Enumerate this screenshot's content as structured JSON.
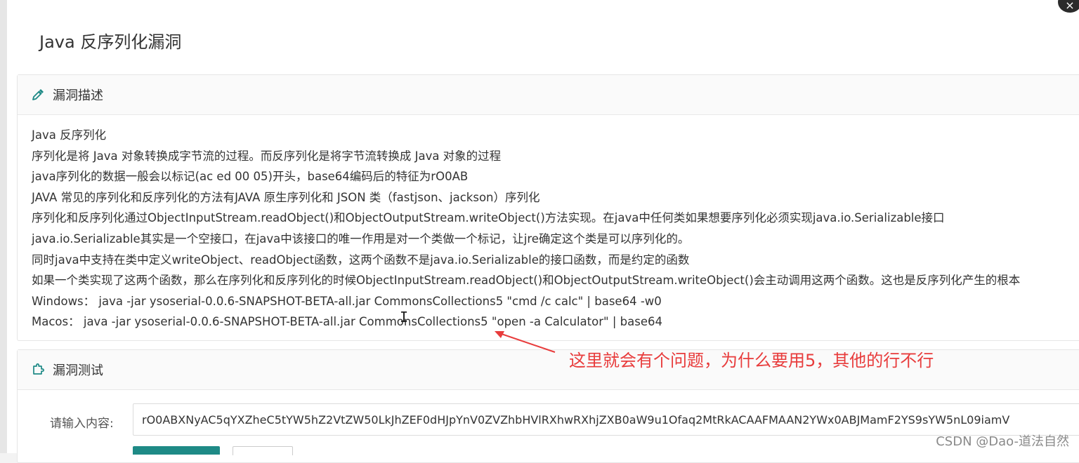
{
  "modal": {
    "title": "Java 反序列化漏洞",
    "close_symbol": "×"
  },
  "description_panel": {
    "heading": "漏洞描述",
    "icon": "eyedropper-icon",
    "lines": [
      "Java 反序列化",
      "序列化是将 Java 对象转换成字节流的过程。而反序列化是将字节流转换成 Java 对象的过程",
      "java序列化的数据一般会以标记(ac ed 00 05)开头，base64编码后的特征为rO0AB",
      "JAVA 常见的序列化和反序列化的方法有JAVA 原生序列化和 JSON 类（fastjson、jackson）序列化",
      "序列化和反序列化通过ObjectInputStream.readObject()和ObjectOutputStream.writeObject()方法实现。在java中任何类如果想要序列化必须实现java.io.Serializable接口",
      "java.io.Serializable其实是一个空接口，在java中该接口的唯一作用是对一个类做一个标记，让jre确定这个类是可以序列化的。",
      "同时java中支持在类中定义writeObject、readObject函数，这两个函数不是java.io.Serializable的接口函数，而是约定的函数",
      "如果一个类实现了这两个函数，那么在序列化和反序列化的时候ObjectInputStream.readObject()和ObjectOutputStream.writeObject()会主动调用这两个函数。这也是反序列化产生的根本",
      "Windows： java -jar ysoserial-0.0.6-SNAPSHOT-BETA-all.jar CommonsCollections5 \"cmd /c calc\" | base64 -w0",
      "Macos： java -jar ysoserial-0.0.6-SNAPSHOT-BETA-all.jar CommonsCollections5 \"open -a Calculator\" | base64"
    ]
  },
  "annotation": {
    "text": "这里就会有个问题，为什么要用5，其他的行不行",
    "color": "#e83c3c"
  },
  "test_panel": {
    "heading": "漏洞测试",
    "icon": "puzzle-icon",
    "input_label": "请输入内容:",
    "input_value": "rO0ABXNyAC5qYXZheC5tYW5hZ2VtZW50LkJhZEF0dHJpYnV0ZVZhbHVlRXhwRXhjZXB0aW9u1Ofaq2MtRkACAAFMAAN2YWx0ABJMamF2YS9sYW5nL09iamV"
  },
  "watermark": {
    "text": "CSDN @Dao-道法自然"
  },
  "colors": {
    "accent": "#1e8a86",
    "panel_border": "#e6e6e6"
  }
}
